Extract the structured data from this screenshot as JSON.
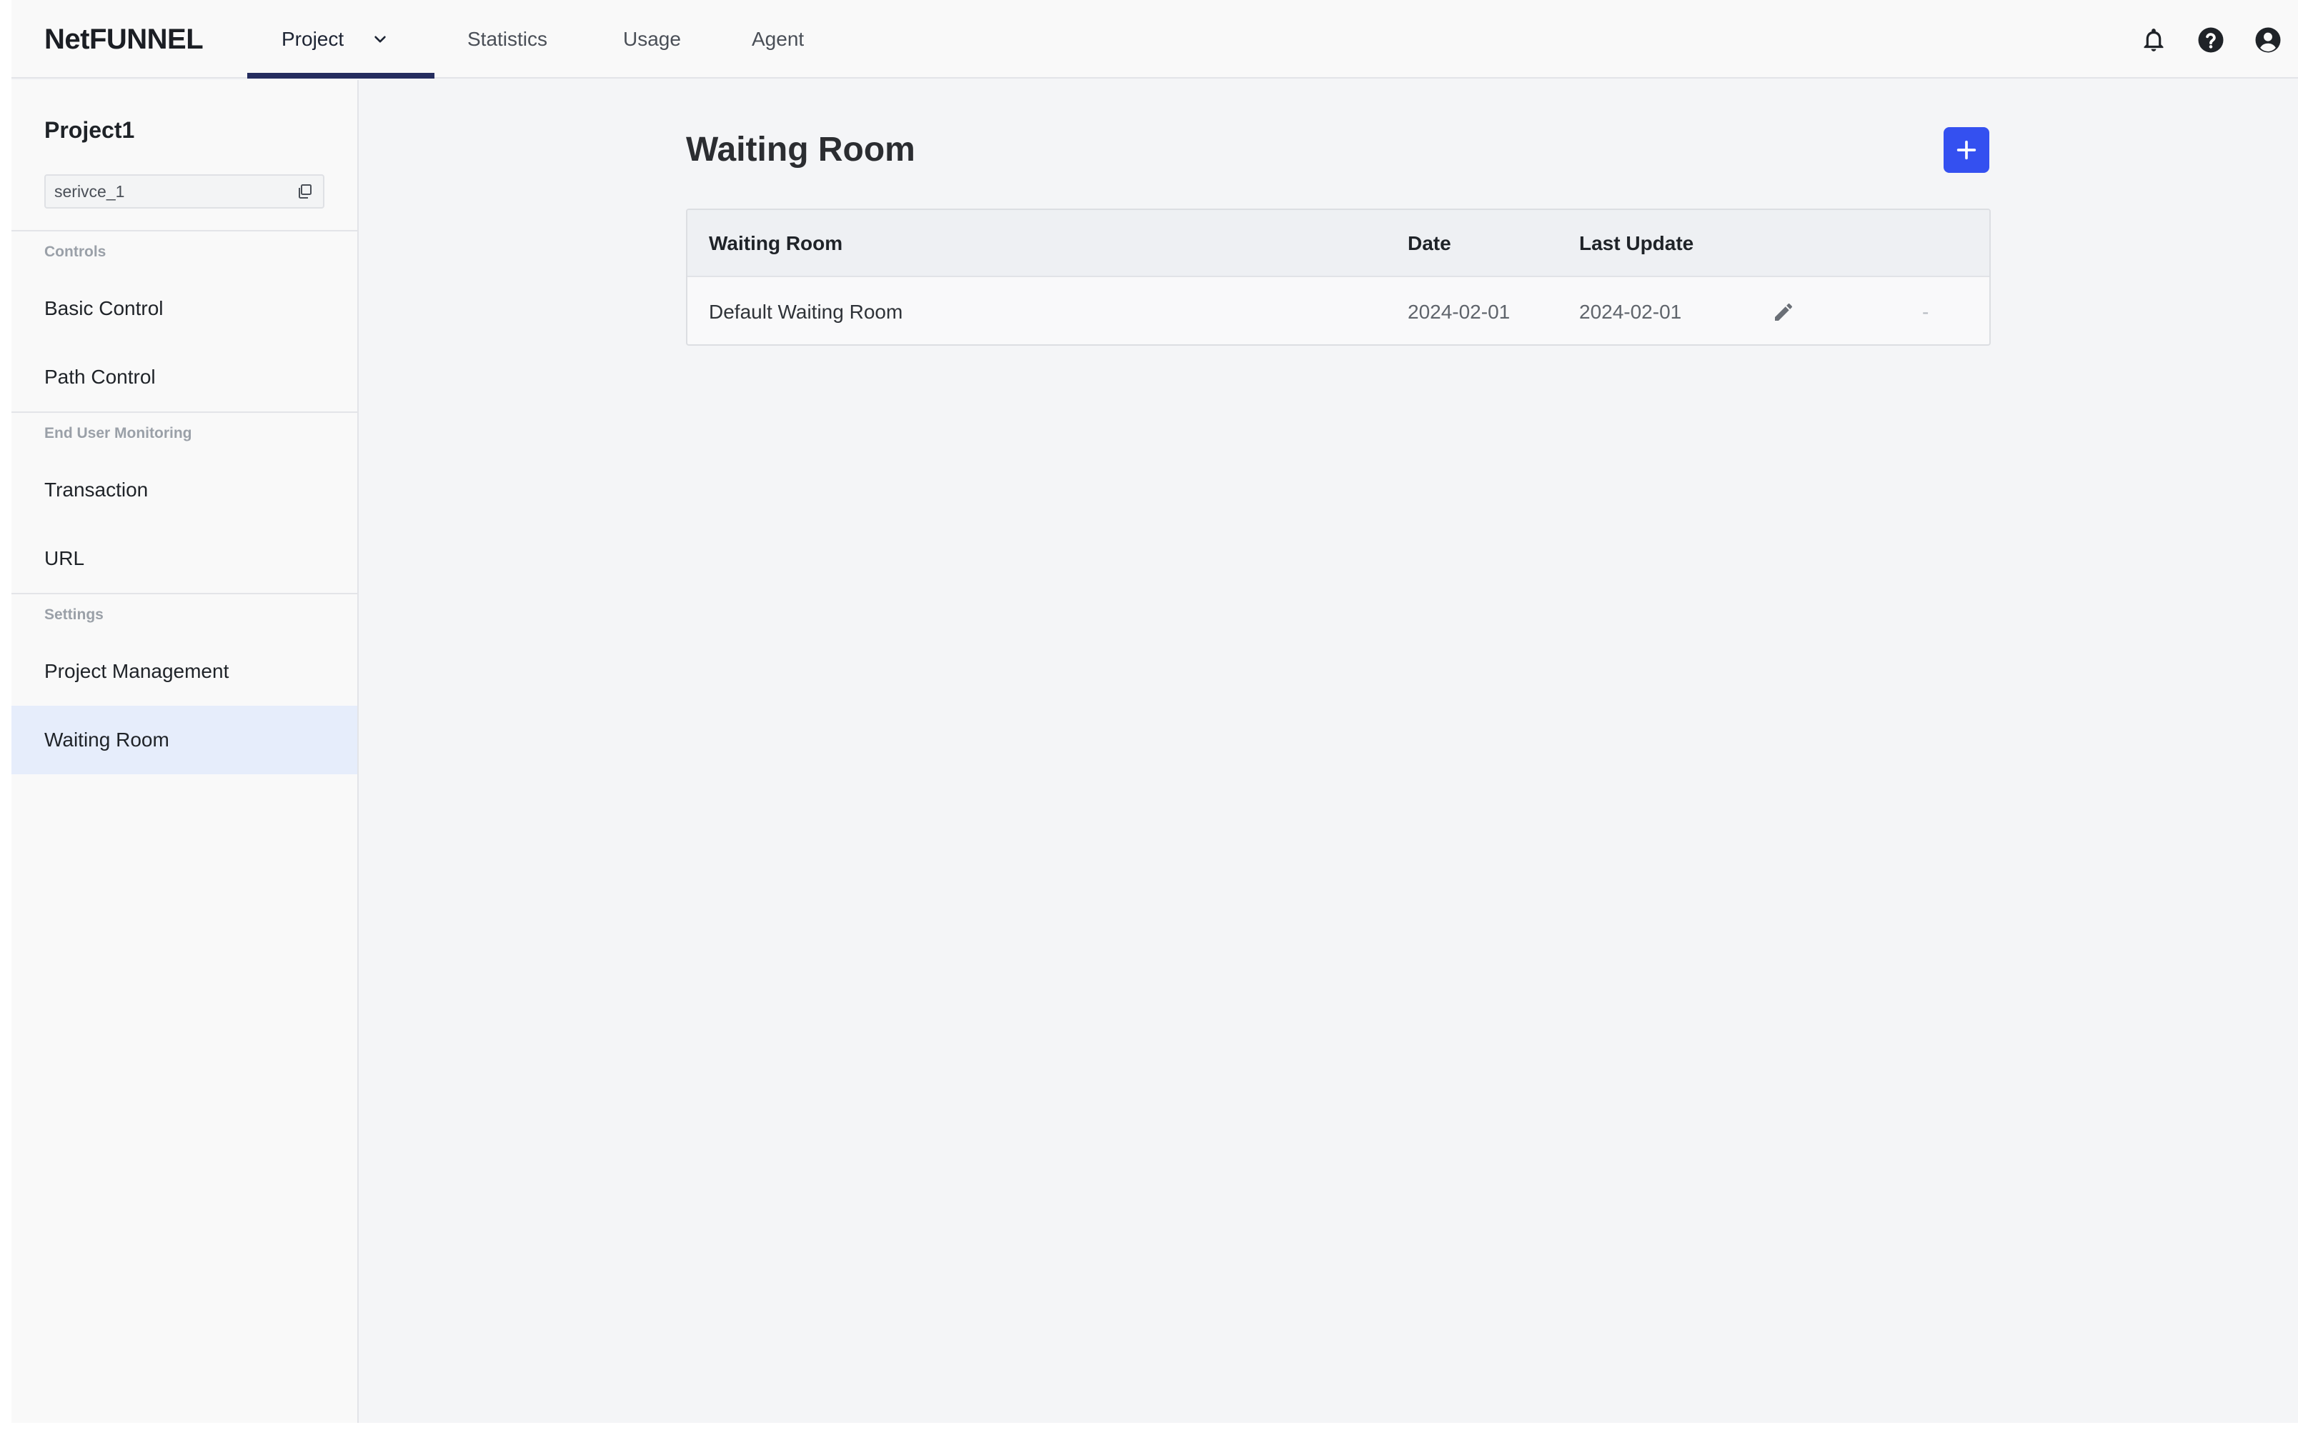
{
  "header": {
    "logo": "NetFUNNEL",
    "tabs": [
      {
        "label": "Project",
        "active": true
      },
      {
        "label": "Statistics"
      },
      {
        "label": "Usage"
      },
      {
        "label": "Agent"
      }
    ],
    "icons": [
      "bell-icon",
      "help-icon",
      "account-icon"
    ]
  },
  "sidebar": {
    "project_name": "Project1",
    "service_id": "serivce_1",
    "sections": [
      {
        "label": "Controls",
        "items": [
          "Basic Control",
          "Path Control"
        ]
      },
      {
        "label": "End User Monitoring",
        "items": [
          "Transaction",
          "URL"
        ]
      },
      {
        "label": "Settings",
        "items": [
          "Project Management",
          "Waiting Room"
        ]
      }
    ],
    "active_item": "Waiting Room"
  },
  "main": {
    "title": "Waiting Room",
    "table": {
      "headers": [
        "Waiting Room",
        "Date",
        "Last Update"
      ],
      "rows": [
        {
          "name": "Default Waiting Room",
          "date": "2024-02-01",
          "last_update": "2024-02-01",
          "extra": "-"
        }
      ]
    }
  },
  "colors": {
    "accent": "#3450f0",
    "active_tab_underline": "#252d5f",
    "active_sidebar_bg": "#e6edfb"
  }
}
